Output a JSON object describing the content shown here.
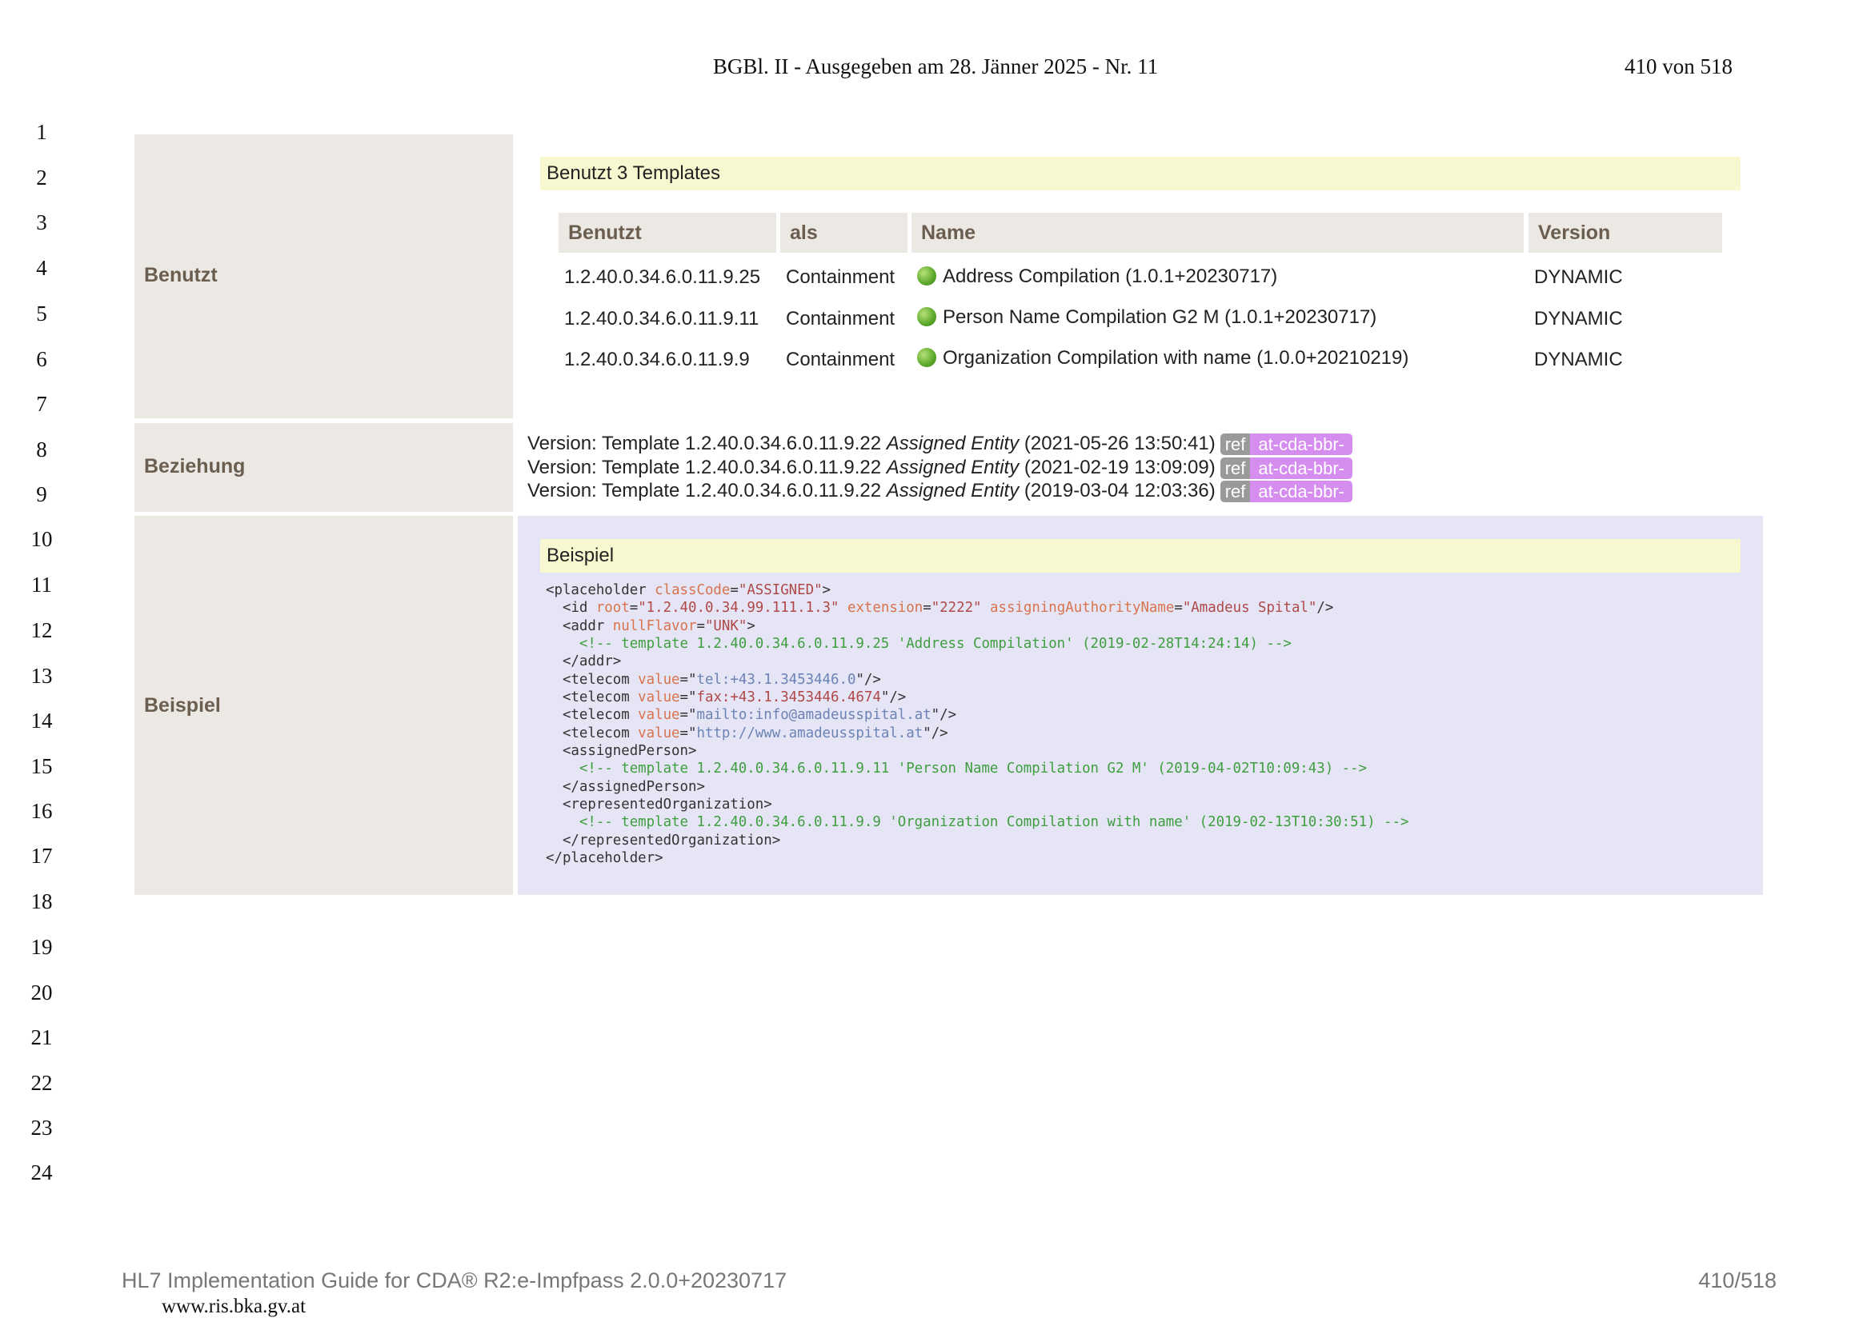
{
  "header": {
    "title": "BGBl. II - Ausgegeben am 28. Jänner 2025 - Nr. 11",
    "page": "410 von 518"
  },
  "line_numbers": [
    "1",
    "2",
    "3",
    "4",
    "5",
    "6",
    "7",
    "8",
    "9",
    "10",
    "11",
    "12",
    "13",
    "14",
    "15",
    "16",
    "17",
    "18",
    "19",
    "20",
    "21",
    "22",
    "23",
    "24"
  ],
  "benutzt": {
    "label": "Benutzt",
    "caption": "Benutzt 3 Templates",
    "columns": [
      "Benutzt",
      "als",
      "Name",
      "Version"
    ],
    "rows": [
      {
        "id": "1.2.40.0.34.6.0.11.9.25",
        "als": "Containment",
        "name": "Address Compilation (1.0.1+20230717)",
        "version": "DYNAMIC"
      },
      {
        "id": "1.2.40.0.34.6.0.11.9.11",
        "als": "Containment",
        "name": "Person Name Compilation G2 M (1.0.1+20230717)",
        "version": "DYNAMIC"
      },
      {
        "id": "1.2.40.0.34.6.0.11.9.9",
        "als": "Containment",
        "name": "Organization Compilation with name (1.0.0+20210219)",
        "version": "DYNAMIC"
      }
    ]
  },
  "beziehung": {
    "label": "Beziehung",
    "lines": [
      {
        "prefix": "Version: Template 1.2.40.0.34.6.0.11.9.22 ",
        "name": "Assigned Entity",
        "date": " (2021‑05‑26 13:50:41)",
        "ref": "ref",
        "badge": "at-cda-bbr-"
      },
      {
        "prefix": "Version: Template 1.2.40.0.34.6.0.11.9.22 ",
        "name": "Assigned Entity",
        "date": " (2021‑02‑19 13:09:09)",
        "ref": "ref",
        "badge": "at-cda-bbr-"
      },
      {
        "prefix": "Version: Template 1.2.40.0.34.6.0.11.9.22 ",
        "name": "Assigned Entity",
        "date": " (2019‑03‑04 12:03:36)",
        "ref": "ref",
        "badge": "at-cda-bbr-"
      }
    ]
  },
  "beispiel": {
    "label": "Beispiel",
    "caption": "Beispiel",
    "code": {
      "l1_tag": "<placeholder ",
      "l1_attr": "classCode",
      "l1_eq": "=",
      "l1_val": "\"ASSIGNED\"",
      "l1_end": ">",
      "l2_tag": "  <id ",
      "l2_a1": "root",
      "l2_v1": "\"1.2.40.0.34.99.111.1.3\"",
      "l2_a2": "extension",
      "l2_v2": "\"2222\"",
      "l2_a3": "assigningAuthorityName",
      "l2_v3": "\"Amadeus Spital\"",
      "l2_end": "/>",
      "l3_tag": "  <addr ",
      "l3_attr": "nullFlavor",
      "l3_val": "\"UNK\"",
      "l3_end": ">",
      "l4_cmt": "    <!-- template 1.2.40.0.34.6.0.11.9.25 'Address Compilation' (2019-02-28T14:24:14) -->",
      "l5": "  </addr>",
      "l6_tag": "  <telecom ",
      "l6_attr": "value",
      "l6_q1": "\"",
      "l6_val": "tel:+43.1.3453446.0",
      "l6_q2": "\"",
      "l6_end": "/>",
      "l7_tag": "  <telecom ",
      "l7_attr": "value",
      "l7_q1": "\"",
      "l7_val": "fax:+43.1.3453446.4674",
      "l7_q2": "\"",
      "l7_end": "/>",
      "l8_tag": "  <telecom ",
      "l8_attr": "value",
      "l8_q1": "\"",
      "l8_val": "mailto:info@amadeusspital.at",
      "l8_q2": "\"",
      "l8_end": "/>",
      "l9_tag": "  <telecom ",
      "l9_attr": "value",
      "l9_q1": "\"",
      "l9_val": "http://www.amadeusspital.at",
      "l9_q2": "\"",
      "l9_end": "/>",
      "l10": "  <assignedPerson>",
      "l11_cmt": "    <!-- template 1.2.40.0.34.6.0.11.9.11 'Person Name Compilation G2 M' (2019-04-02T10:09:43) -->",
      "l12": "  </assignedPerson>",
      "l13": "  <representedOrganization>",
      "l14_cmt": "    <!-- template 1.2.40.0.34.6.0.11.9.9 'Organization Compilation with name' (2019-02-13T10:30:51) -->",
      "l15": "  </representedOrganization>",
      "l16": "</placeholder>"
    }
  },
  "footer": {
    "left": "HL7 Implementation Guide for CDA® R2:e-Impfpass 2.0.0+20230717",
    "right": "410/518",
    "url": "www.ris.bka.gv.at"
  }
}
